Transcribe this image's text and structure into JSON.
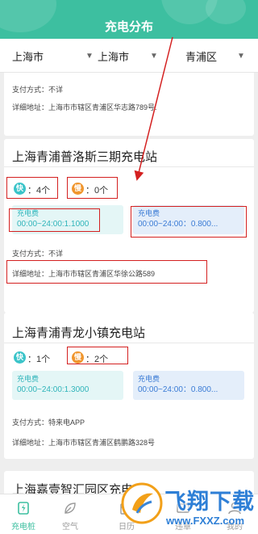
{
  "header": {
    "title": "充电分布",
    "bg_color": "#3dbfa0"
  },
  "filters": [
    {
      "label": "上海市"
    },
    {
      "label": "上海市"
    },
    {
      "label": "青浦区"
    }
  ],
  "partial_card": {
    "payment": "支付方式：不详",
    "address": "详细地址：上海市市辖区青浦区华志路789号."
  },
  "stations": [
    {
      "name": "上海青浦普洛斯三期充电站",
      "fast": {
        "icon_text": "快",
        "count": "：4个"
      },
      "slow": {
        "icon_text": "慢",
        "count": "：0个"
      },
      "fee_a": {
        "label": "充电费",
        "time": "00:00~24:00:1.1000"
      },
      "fee_b": {
        "label": "充电费",
        "time": "00:00~24:00：0.800..."
      },
      "payment": "支付方式：不详",
      "address": "详细地址：上海市市辖区青浦区华徐公路589"
    },
    {
      "name": "上海青浦青龙小镇充电站",
      "fast": {
        "icon_text": "快",
        "count": "：1个"
      },
      "slow": {
        "icon_text": "慢",
        "count": "：2个"
      },
      "fee_a": {
        "label": "充电费",
        "time": "00:00~24:00:1.3000"
      },
      "fee_b": {
        "label": "充电费",
        "time": "00:00~24:00：0.800..."
      },
      "payment": "支付方式：特来电APP",
      "address": "详细地址：上海市市辖区青浦区鹤鹏路328号"
    },
    {
      "name": "上海嘉壹智汇园区充电"
    }
  ],
  "tabs": [
    {
      "label": "充电桩",
      "icon": "charger-icon",
      "active": true
    },
    {
      "label": "空气",
      "icon": "leaf-icon",
      "active": false
    },
    {
      "label": "日历",
      "icon": "calendar-icon",
      "active": false
    },
    {
      "label": "违章",
      "icon": "ticket-icon",
      "active": false
    },
    {
      "label": "我的",
      "icon": "user-icon",
      "active": false
    }
  ],
  "watermark": {
    "brand": "飞翔下载",
    "url": "www.FXXZ.com"
  },
  "colors": {
    "accent": "#3dbfa0",
    "fast": "#3bc4c9",
    "slow": "#f0962e",
    "annotation": "#d42020"
  }
}
